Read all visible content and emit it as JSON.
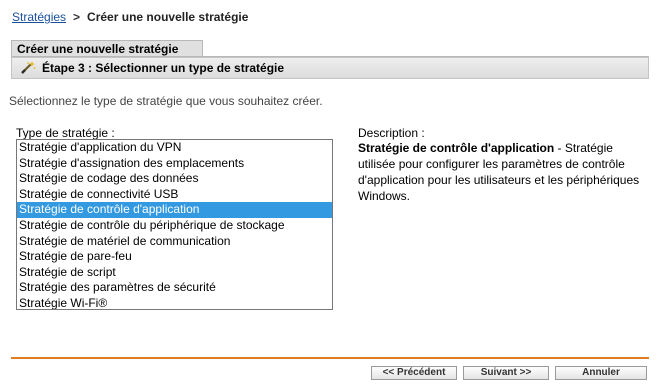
{
  "breadcrumb": {
    "root": "Stratégies",
    "separator": ">",
    "current": "Créer une nouvelle stratégie"
  },
  "wizard": {
    "tab_title": "Créer une nouvelle stratégie",
    "step_title": "Étape 3 : Sélectionner un type de stratégie",
    "step_icon": "wand-icon"
  },
  "instruction": "Sélectionnez le type de stratégie que vous souhaitez créer.",
  "policy_types": {
    "label": "Type de stratégie :",
    "selected_index": 4,
    "options": [
      "Stratégie d'application du VPN",
      "Stratégie d'assignation des emplacements",
      "Stratégie de codage des données",
      "Stratégie de connectivité USB",
      "Stratégie de contrôle d'application",
      "Stratégie de contrôle du périphérique de stockage",
      "Stratégie de matériel de communication",
      "Stratégie de pare-feu",
      "Stratégie de script",
      "Stratégie des paramètres de sécurité",
      "Stratégie Wi-Fi®"
    ]
  },
  "description": {
    "label": "Description :",
    "title": "Stratégie de contrôle d'application",
    "text": " - Stratégie utilisée pour configurer les paramètres de contrôle d'application pour les utilisateurs et les périphériques Windows."
  },
  "buttons": {
    "previous": "<< Précédent",
    "next": "Suivant >>",
    "cancel": "Annuler"
  },
  "colors": {
    "link": "#1a4f9c",
    "selection": "#3399e0",
    "divider": "#e07c22"
  }
}
